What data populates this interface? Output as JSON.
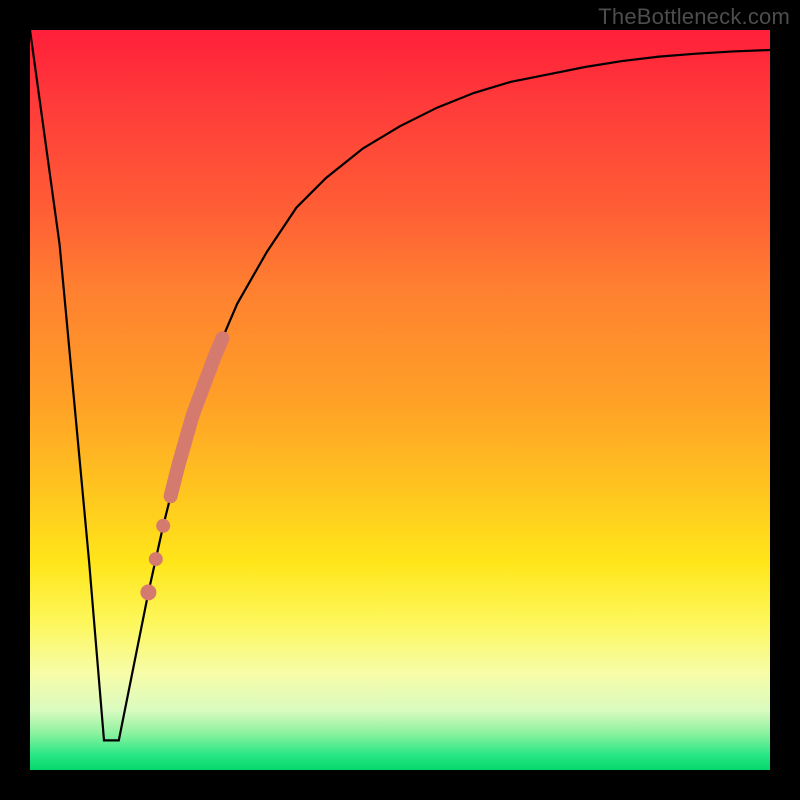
{
  "watermark": "TheBottleneck.com",
  "chart_data": {
    "type": "line",
    "title": "",
    "xlabel": "",
    "ylabel": "",
    "xlim": [
      0,
      100
    ],
    "ylim": [
      0,
      100
    ],
    "series": [
      {
        "name": "bottleneck-curve",
        "x": [
          0,
          4,
          8,
          10,
          12,
          14,
          16,
          18,
          20,
          22,
          25,
          28,
          32,
          36,
          40,
          45,
          50,
          55,
          60,
          65,
          70,
          75,
          80,
          85,
          90,
          95,
          100
        ],
        "values": [
          100,
          71,
          28,
          4,
          4,
          14,
          24,
          33,
          41,
          48,
          56,
          63,
          70,
          76,
          80,
          84,
          87,
          89.5,
          91.5,
          93,
          94,
          95,
          95.8,
          96.4,
          96.8,
          97.1,
          97.3
        ]
      }
    ],
    "markers": [
      {
        "name": "highlight-segment",
        "x_start": 19,
        "x_end": 26,
        "color": "#d47a6f",
        "width": 14
      },
      {
        "name": "dot-1",
        "x": 18.0,
        "color": "#d47a6f",
        "radius": 7
      },
      {
        "name": "dot-2",
        "x": 17.0,
        "color": "#d47a6f",
        "radius": 7
      },
      {
        "name": "dot-3",
        "x": 16.0,
        "color": "#d47a6f",
        "radius": 8
      }
    ]
  }
}
